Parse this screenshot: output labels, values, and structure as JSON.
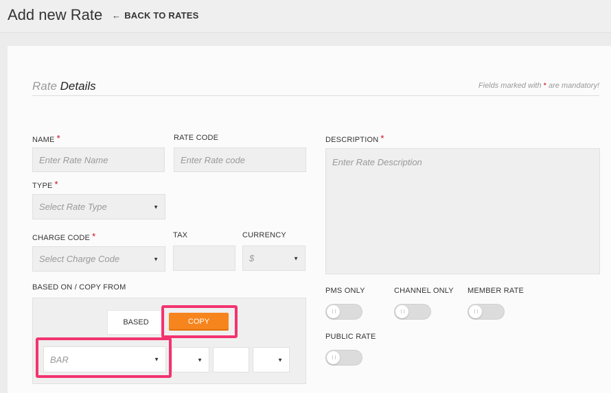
{
  "header": {
    "title": "Add new Rate",
    "back_label": "BACK TO RATES",
    "back_arrow": "←"
  },
  "section": {
    "title_light": "Rate",
    "title_strong": "Details",
    "mandatory_prefix": "Fields marked with",
    "mandatory_star": "*",
    "mandatory_suffix": "are mandatory!"
  },
  "fields": {
    "name": {
      "label": "NAME",
      "required": "*",
      "placeholder": "Enter Rate Name"
    },
    "rate_code": {
      "label": "RATE CODE",
      "placeholder": "Enter Rate code"
    },
    "description": {
      "label": "DESCRIPTION",
      "required": "*",
      "placeholder": "Enter Rate Description"
    },
    "type": {
      "label": "TYPE",
      "required": "*",
      "placeholder": "Select Rate Type"
    },
    "charge_code": {
      "label": "CHARGE CODE",
      "required": "*",
      "placeholder": "Select Charge Code"
    },
    "tax": {
      "label": "TAX",
      "value": ""
    },
    "currency": {
      "label": "CURRENCY",
      "value": "$"
    },
    "based_on": {
      "label": "BASED ON / COPY FROM"
    }
  },
  "based_copy": {
    "based_label": "BASED",
    "copy_label": "COPY",
    "rate_select_value": "BAR",
    "caret": "▼"
  },
  "toggles": {
    "pms_only": {
      "label": "PMS ONLY",
      "on": false
    },
    "channel_only": {
      "label": "CHANNEL ONLY",
      "on": false
    },
    "member_rate": {
      "label": "MEMBER RATE",
      "on": false
    },
    "public_rate": {
      "label": "PUBLIC RATE",
      "on": false
    }
  },
  "colors": {
    "accent_orange": "#f7851e",
    "highlight_pink": "#f3336f",
    "required_red": "#d0021b"
  }
}
